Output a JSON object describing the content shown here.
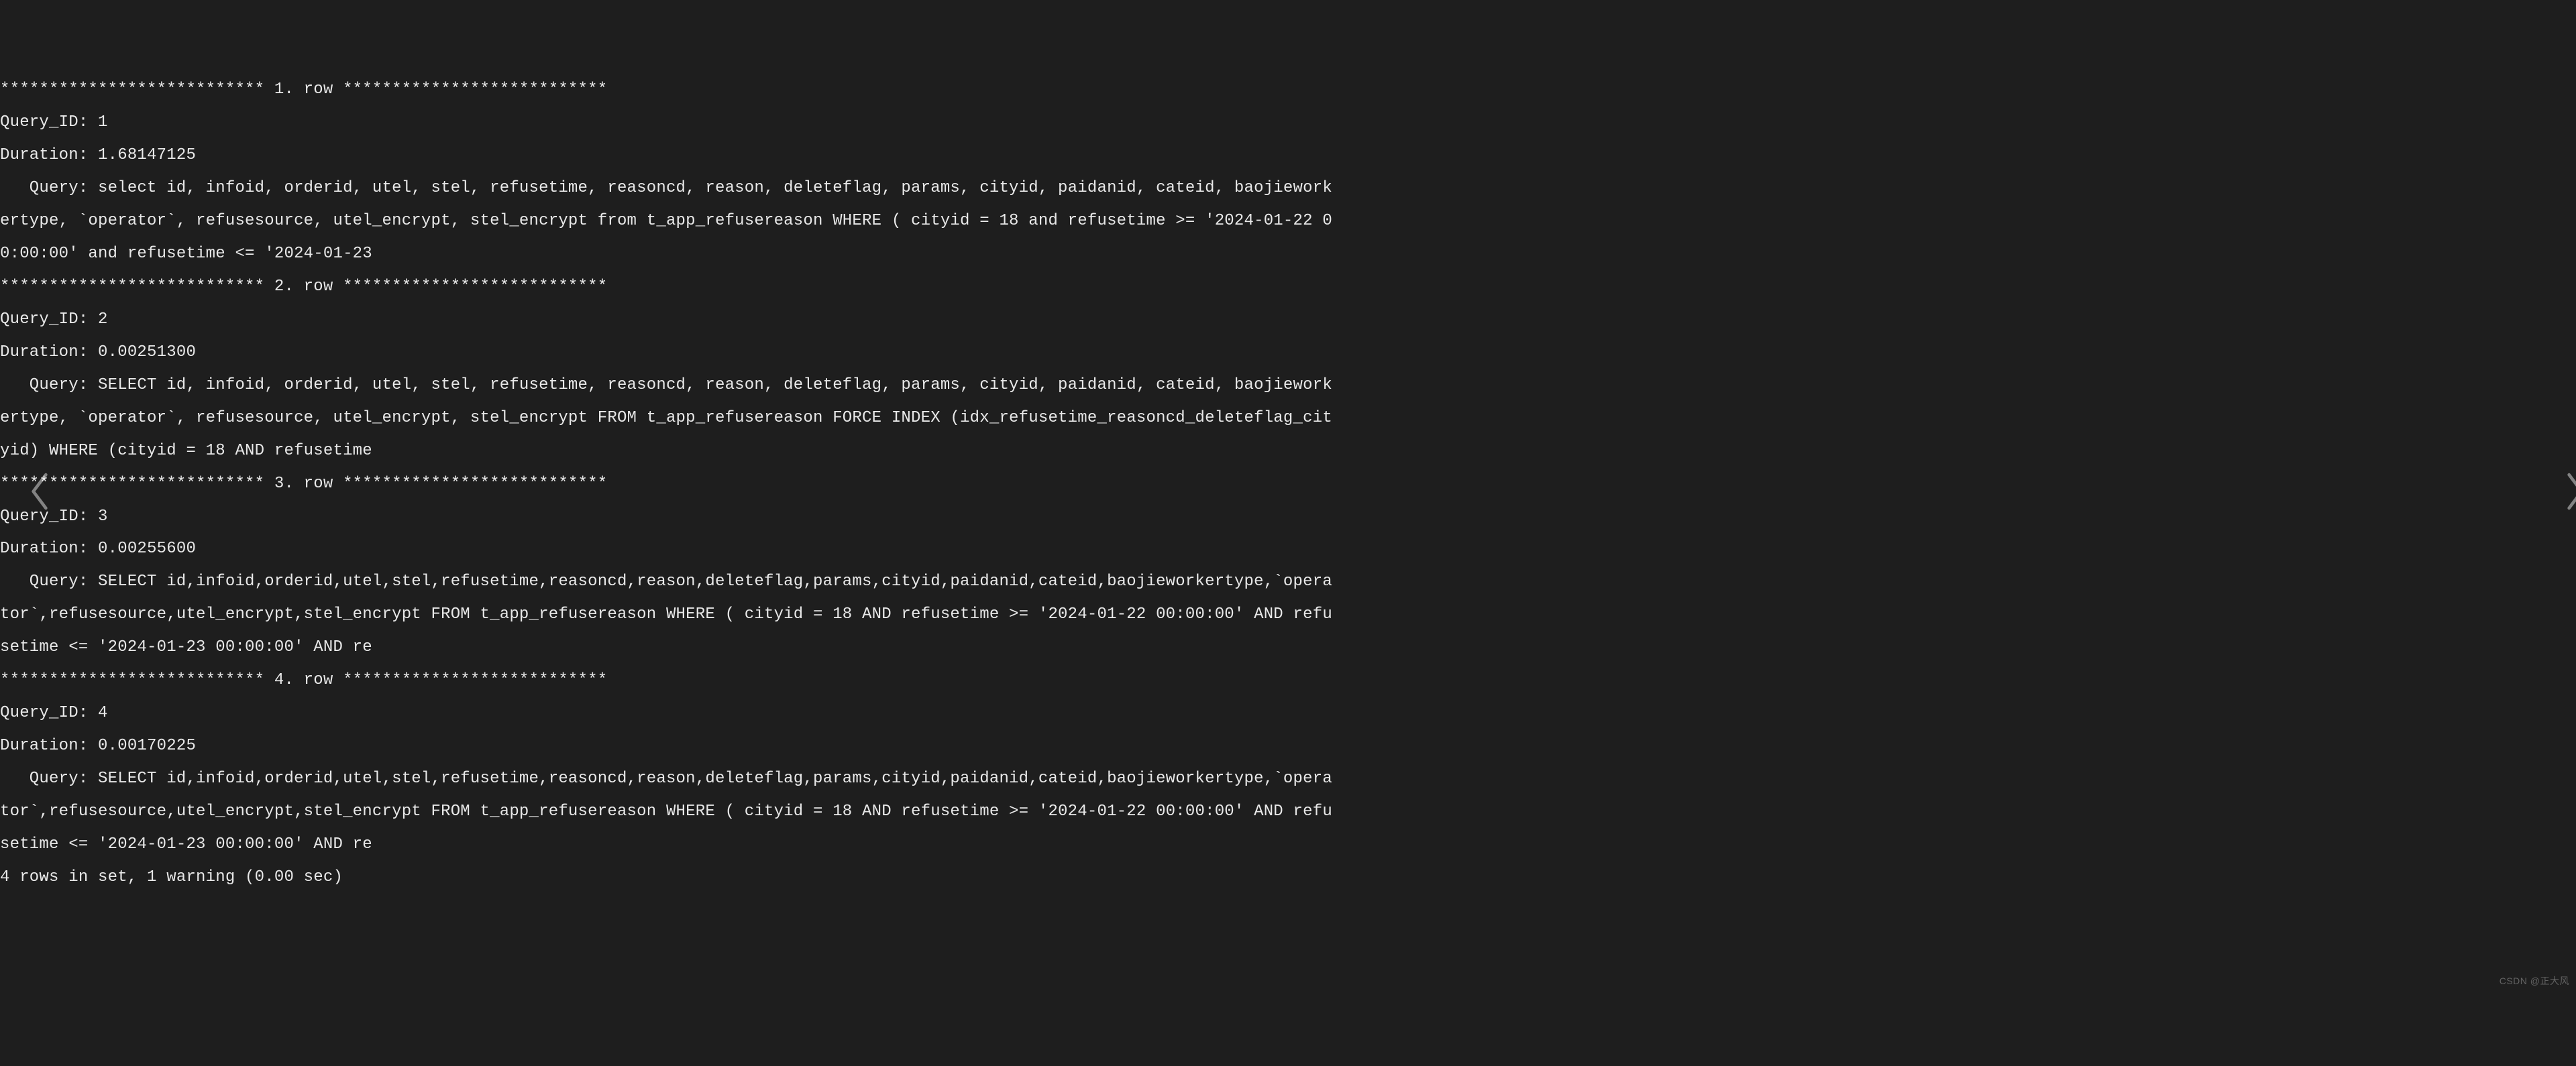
{
  "rows": [
    {
      "header": "*************************** 1. row ***************************",
      "query_id": "Query_ID: 1",
      "duration": "Duration: 1.68147125",
      "query_lines": [
        "   Query: select id, infoid, orderid, utel, stel, refusetime, reasoncd, reason, deleteflag, params, cityid, paidanid, cateid, baojiework",
        "ertype, `operator`, refusesource, utel_encrypt, stel_encrypt from t_app_refusereason WHERE ( cityid = 18 and refusetime >= '2024-01-22 0",
        "0:00:00' and refusetime <= '2024-01-23"
      ]
    },
    {
      "header": "*************************** 2. row ***************************",
      "query_id": "Query_ID: 2",
      "duration": "Duration: 0.00251300",
      "query_lines": [
        "   Query: SELECT id, infoid, orderid, utel, stel, refusetime, reasoncd, reason, deleteflag, params, cityid, paidanid, cateid, baojiework",
        "ertype, `operator`, refusesource, utel_encrypt, stel_encrypt FROM t_app_refusereason FORCE INDEX (idx_refusetime_reasoncd_deleteflag_cit",
        "yid) WHERE (cityid = 18 AND refusetime"
      ]
    },
    {
      "header": "*************************** 3. row ***************************",
      "query_id": "Query_ID: 3",
      "duration": "Duration: 0.00255600",
      "query_lines": [
        "   Query: SELECT id,infoid,orderid,utel,stel,refusetime,reasoncd,reason,deleteflag,params,cityid,paidanid,cateid,baojieworkertype,`opera",
        "tor`,refusesource,utel_encrypt,stel_encrypt FROM t_app_refusereason WHERE ( cityid = 18 AND refusetime >= '2024-01-22 00:00:00' AND refu",
        "setime <= '2024-01-23 00:00:00' AND re"
      ]
    },
    {
      "header": "*************************** 4. row ***************************",
      "query_id": "Query_ID: 4",
      "duration": "Duration: 0.00170225",
      "query_lines": [
        "   Query: SELECT id,infoid,orderid,utel,stel,refusetime,reasoncd,reason,deleteflag,params,cityid,paidanid,cateid,baojieworkertype,`opera",
        "tor`,refusesource,utel_encrypt,stel_encrypt FROM t_app_refusereason WHERE ( cityid = 18 AND refusetime >= '2024-01-22 00:00:00' AND refu",
        "setime <= '2024-01-23 00:00:00' AND re"
      ]
    }
  ],
  "footer": "4 rows in set, 1 warning (0.00 sec)",
  "watermark": "CSDN @正大风"
}
